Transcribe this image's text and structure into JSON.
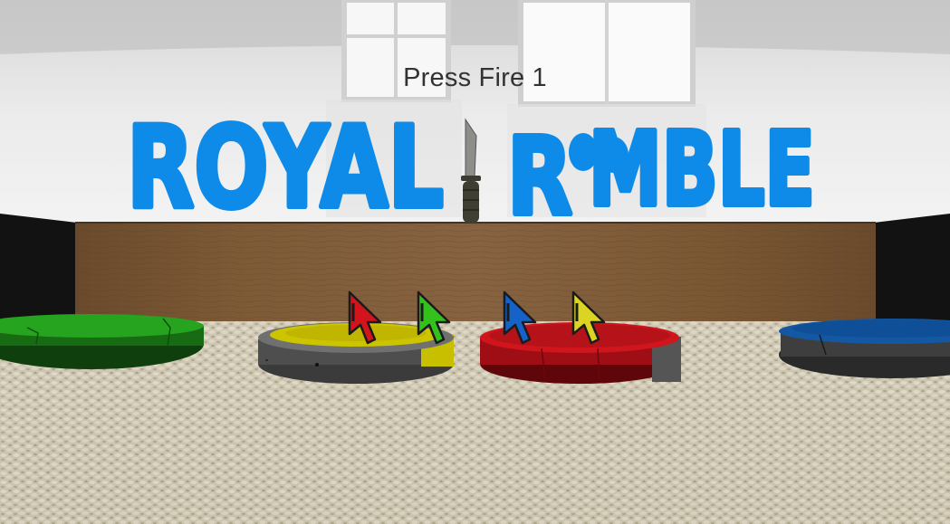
{
  "prompt_text": "Press Fire 1",
  "logo": {
    "text": "ROYAL ROOMBLE",
    "word1": "ROYAL",
    "word2_start": "R",
    "word2_oo": "OO",
    "word2_end": "MBLE",
    "color": "#0e8be8"
  },
  "roombas": [
    {
      "name": "green-roomba",
      "color": "#1f8a1a"
    },
    {
      "name": "yellow-roomba",
      "color": "#c9c200"
    },
    {
      "name": "red-roomba",
      "color": "#c8141c"
    },
    {
      "name": "blue-roomba",
      "color": "#0e4f97"
    }
  ],
  "player_cursors": [
    {
      "name": "red-player-cursor-icon",
      "color": "#d4141c"
    },
    {
      "name": "green-player-cursor-icon",
      "color": "#33c21c"
    },
    {
      "name": "blue-player-cursor-icon",
      "color": "#1563c9"
    },
    {
      "name": "yellow-player-cursor-icon",
      "color": "#dcd423"
    }
  ]
}
